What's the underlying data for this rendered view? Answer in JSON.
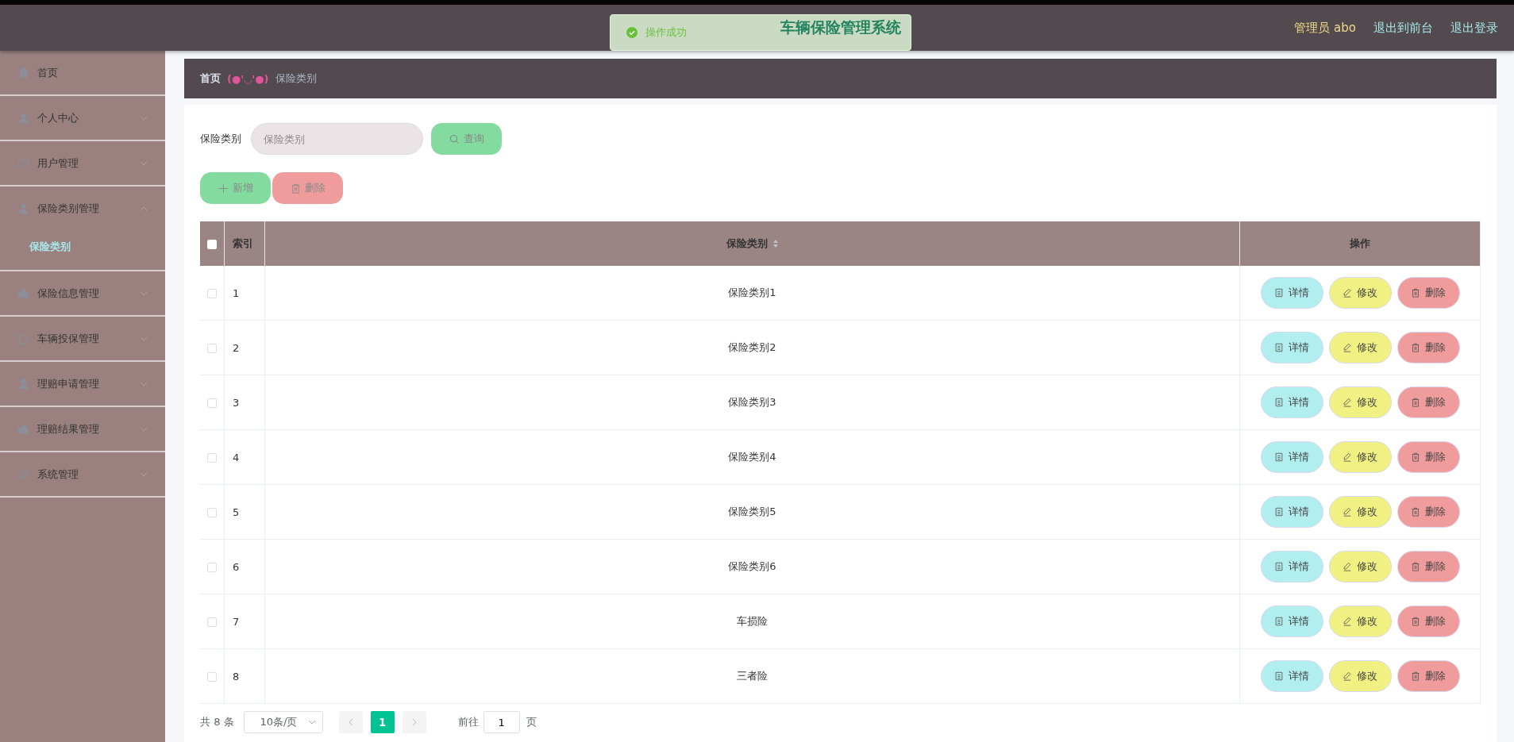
{
  "header": {
    "title": "车辆保险管理系统",
    "user": "管理员 abo",
    "links": [
      "退出到前台",
      "退出登录"
    ]
  },
  "toast": {
    "message": "操作成功"
  },
  "sidebar": {
    "items": [
      {
        "label": "首页",
        "expandable": false
      },
      {
        "label": "个人中心",
        "expandable": true,
        "expanded": false
      },
      {
        "label": "用户管理",
        "expandable": true,
        "expanded": false
      },
      {
        "label": "保险类别管理",
        "expandable": true,
        "expanded": true,
        "children": [
          {
            "label": "保险类别",
            "selected": true
          }
        ]
      },
      {
        "label": "保险信息管理",
        "expandable": true,
        "expanded": false
      },
      {
        "label": "车辆投保管理",
        "expandable": true,
        "expanded": false
      },
      {
        "label": "理赔申请管理",
        "expandable": true,
        "expanded": false
      },
      {
        "label": "理赔结果管理",
        "expandable": true,
        "expanded": false
      },
      {
        "label": "系统管理",
        "expandable": true,
        "expanded": false
      }
    ]
  },
  "breadcrumb": {
    "home": "首页",
    "separator": "(●'◡'●)",
    "current": "保险类别"
  },
  "search": {
    "label": "保险类别",
    "placeholder": "保险类别",
    "button": "查询"
  },
  "toolbar": [
    {
      "label": "新增",
      "kind": "add"
    },
    {
      "label": "删除",
      "kind": "delete"
    }
  ],
  "table": {
    "header_checked": false,
    "columns": [
      {
        "label": "索引"
      },
      {
        "label": "保险类别",
        "sortable": true
      },
      {
        "label": "操作"
      }
    ],
    "rows": [
      {
        "checked": false,
        "index": "1",
        "category": "保险类别1",
        "actions": [
          {
            "label": "详情",
            "kind": "detail"
          },
          {
            "label": "修改",
            "kind": "edit"
          },
          {
            "label": "删除",
            "kind": "delete"
          }
        ]
      },
      {
        "checked": false,
        "index": "2",
        "category": "保险类别2",
        "actions": [
          {
            "label": "详情",
            "kind": "detail"
          },
          {
            "label": "修改",
            "kind": "edit"
          },
          {
            "label": "删除",
            "kind": "delete"
          }
        ]
      },
      {
        "checked": false,
        "index": "3",
        "category": "保险类别3",
        "actions": [
          {
            "label": "详情",
            "kind": "detail"
          },
          {
            "label": "修改",
            "kind": "edit"
          },
          {
            "label": "删除",
            "kind": "delete"
          }
        ]
      },
      {
        "checked": false,
        "index": "4",
        "category": "保险类别4",
        "actions": [
          {
            "label": "详情",
            "kind": "detail"
          },
          {
            "label": "修改",
            "kind": "edit"
          },
          {
            "label": "删除",
            "kind": "delete"
          }
        ]
      },
      {
        "checked": false,
        "index": "5",
        "category": "保险类别5",
        "actions": [
          {
            "label": "详情",
            "kind": "detail"
          },
          {
            "label": "修改",
            "kind": "edit"
          },
          {
            "label": "删除",
            "kind": "delete"
          }
        ]
      },
      {
        "checked": false,
        "index": "6",
        "category": "保险类别6",
        "actions": [
          {
            "label": "详情",
            "kind": "detail"
          },
          {
            "label": "修改",
            "kind": "edit"
          },
          {
            "label": "删除",
            "kind": "delete"
          }
        ]
      },
      {
        "checked": false,
        "index": "7",
        "category": "车损险",
        "actions": [
          {
            "label": "详情",
            "kind": "detail"
          },
          {
            "label": "修改",
            "kind": "edit"
          },
          {
            "label": "删除",
            "kind": "delete"
          }
        ]
      },
      {
        "checked": false,
        "index": "8",
        "category": "三者险",
        "actions": [
          {
            "label": "详情",
            "kind": "detail"
          },
          {
            "label": "修改",
            "kind": "edit"
          },
          {
            "label": "删除",
            "kind": "delete"
          }
        ]
      }
    ]
  },
  "pagination": {
    "total": "共 8 条",
    "page_size": "10条/页",
    "pages": [
      {
        "label": "1",
        "selected": true
      }
    ],
    "goto_label": "前往",
    "goto_value": "1",
    "goto_suffix": "页"
  }
}
